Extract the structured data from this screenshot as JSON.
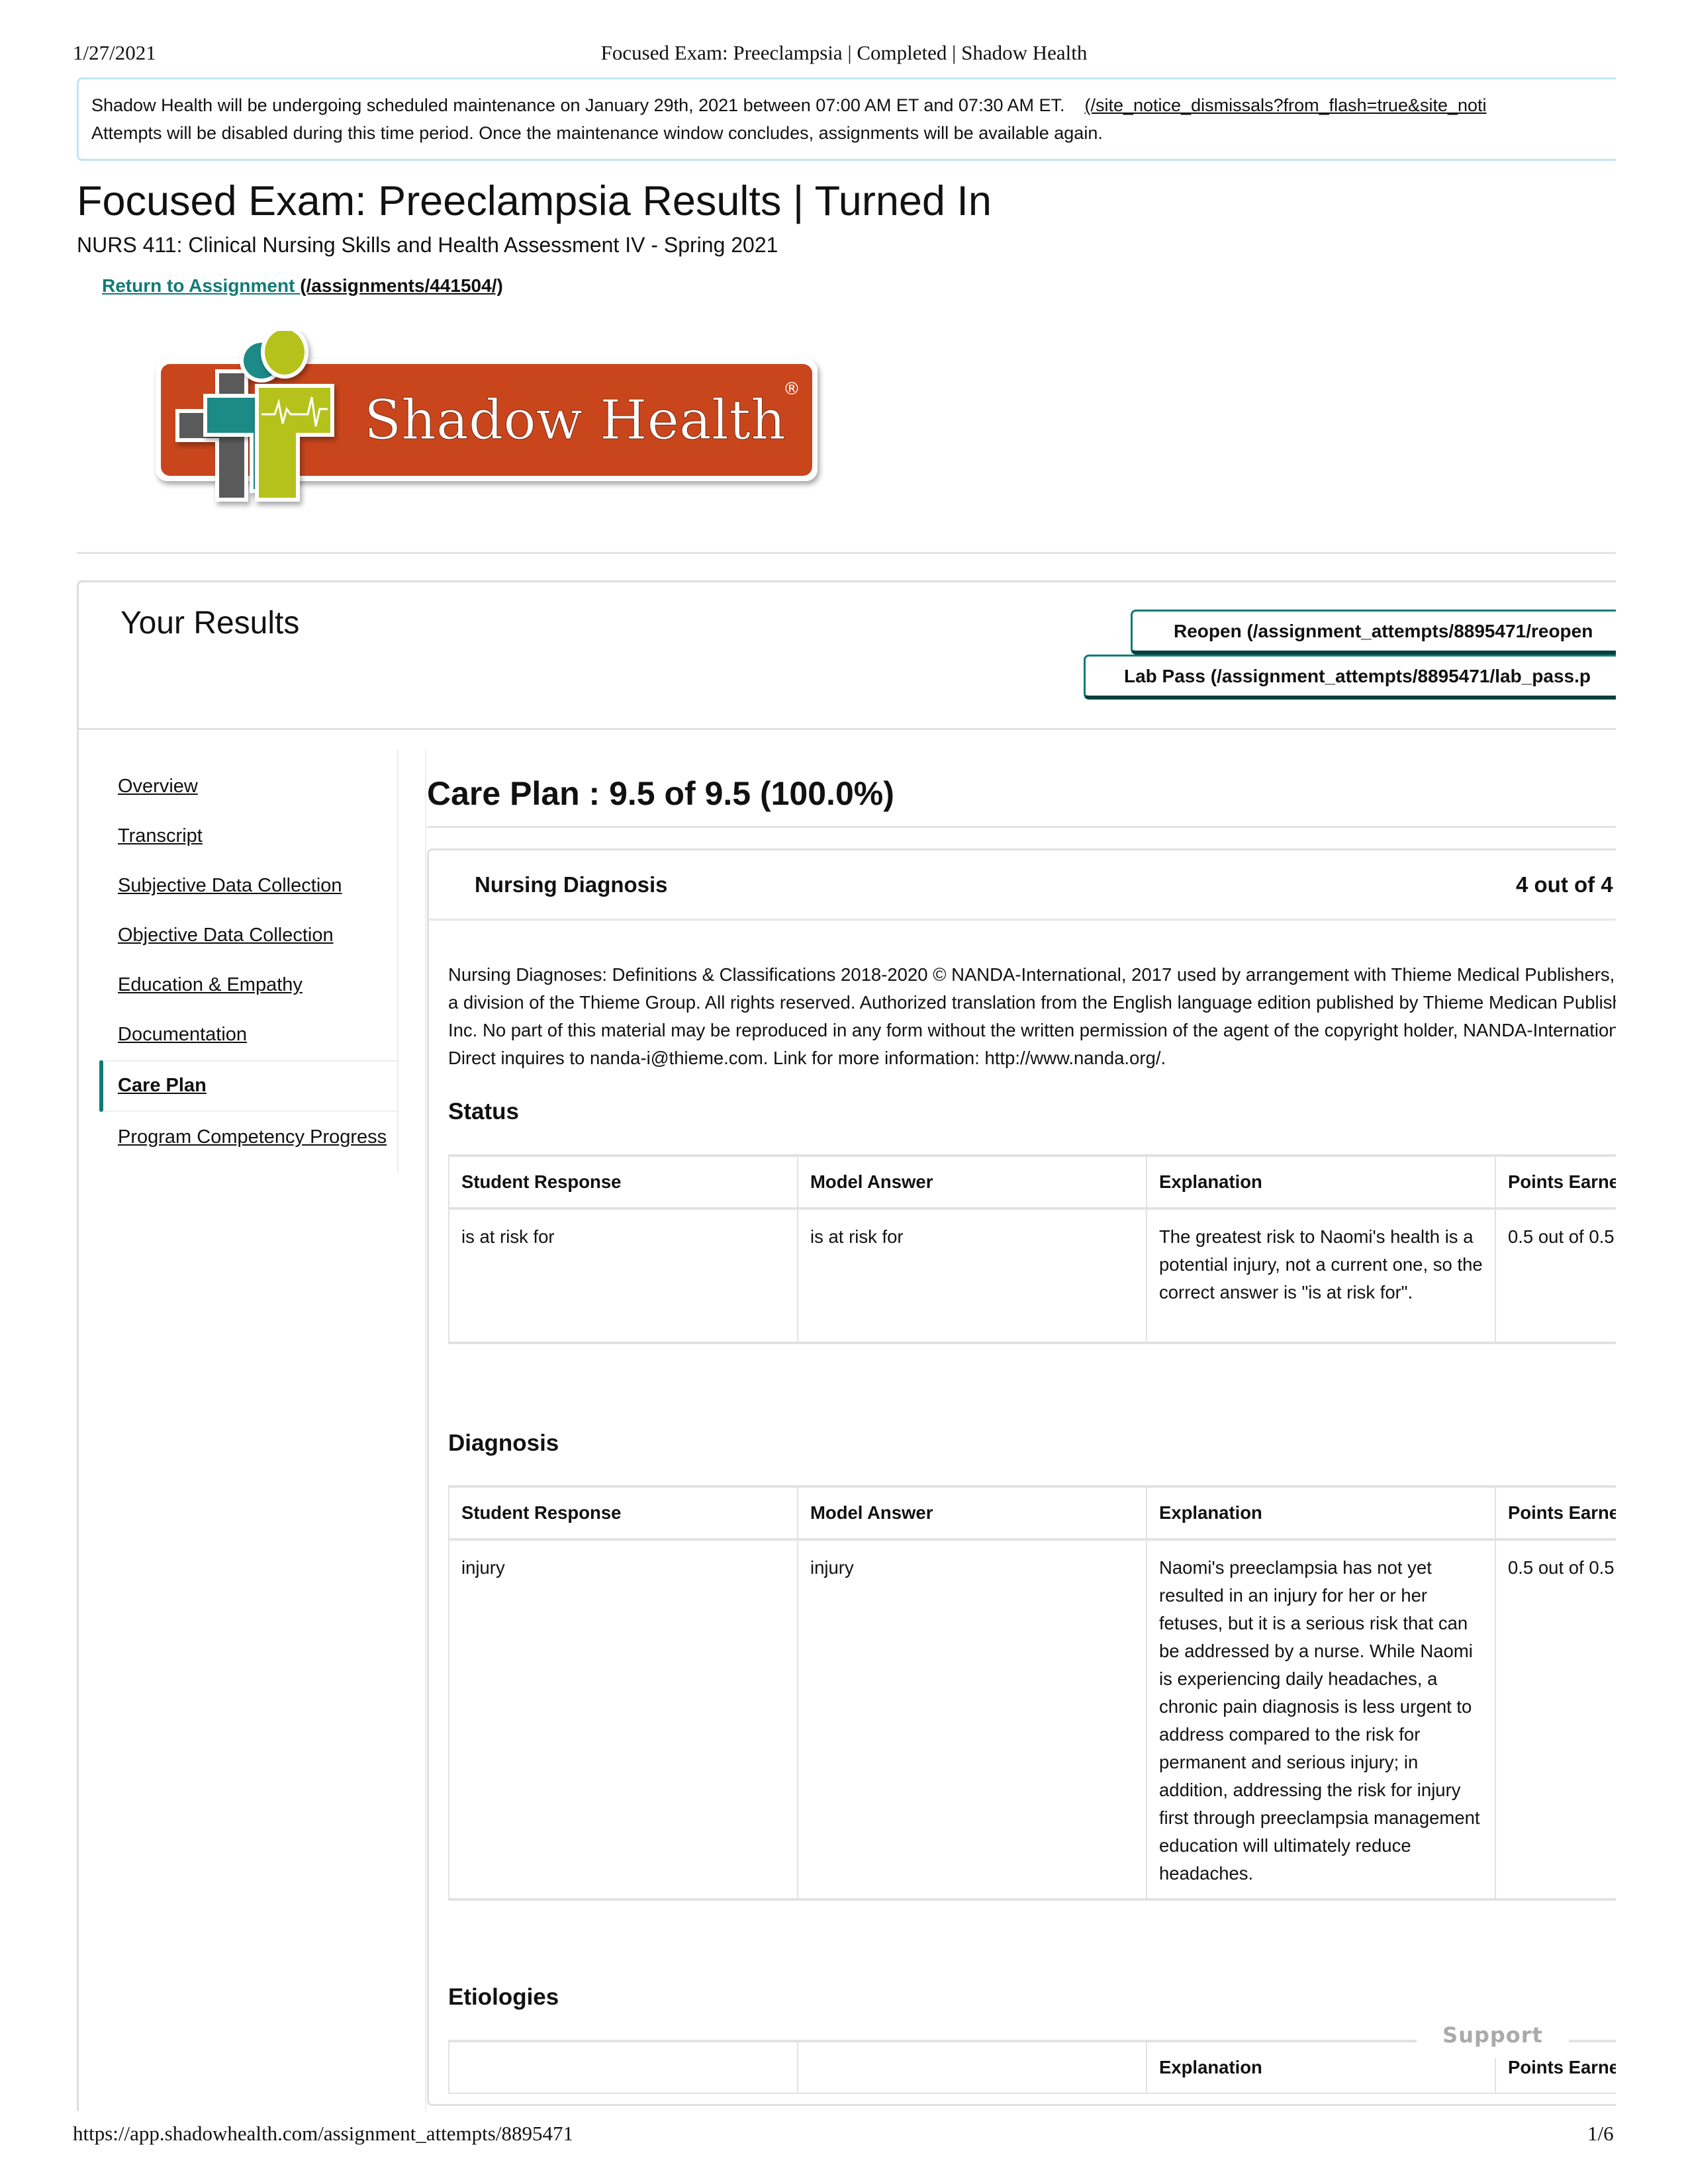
{
  "print_header": {
    "date": "1/27/2021",
    "title": "Focused Exam: Preeclampsia | Completed | Shadow Health"
  },
  "notice": {
    "line1": "Shadow Health will be undergoing scheduled maintenance on January 29th, 2021 between 07:00 AM ET and 07:30 AM ET.",
    "dismiss_link": "(/site_notice_dismissals?from_flash=true&site_noti",
    "line2": "Attempts will be disabled during this time period. Once the maintenance window concludes, assignments will be available again."
  },
  "page": {
    "title": "Focused Exam: Preeclampsia Results | Turned In",
    "subtitle": "NURS 411: Clinical Nursing Skills and Health Assessment IV - Spring 2021",
    "return_link": "Return to Assignment ",
    "return_path": "(/assignments/441504/)"
  },
  "logo": {
    "text": "Shadow Health",
    "registered": "®",
    "colors": {
      "banner": "#c9461d",
      "teal": "#1b8a87",
      "lime": "#b5c21a",
      "gray": "#5a5a5a"
    }
  },
  "results": {
    "heading": "Your Results",
    "reopen_button": "Reopen (/assignment_attempts/8895471/reopen",
    "lab_pass_button": "Lab Pass (/assignment_attempts/8895471/lab_pass.p"
  },
  "sidebar": {
    "items": [
      {
        "label": "Overview",
        "active": false
      },
      {
        "label": "Transcript",
        "active": false
      },
      {
        "label": "Subjective Data Collection",
        "active": false
      },
      {
        "label": "Objective Data Collection",
        "active": false
      },
      {
        "label": "Education & Empathy",
        "active": false
      },
      {
        "label": "Documentation",
        "active": false
      },
      {
        "label": "Care Plan",
        "active": true
      },
      {
        "label": "Program Competency Progress",
        "active": false
      }
    ]
  },
  "main": {
    "heading": "Care Plan : 9.5 of 9.5 (100.0%)",
    "nursing_diagnosis": {
      "title": "Nursing Diagnosis",
      "score": "4 out of 4",
      "copyright": "Nursing Diagnoses: Definitions & Classifications 2018-2020 © NANDA-International, 2017 used by arrangement with Thieme Medical Publishers, Inc., a division of the Thieme Group. All rights reserved. Authorized translation from the English language edition published by Thieme Medican Publishers Inc. No part of this material may be reproduced in any form without the written permission of the agent of the copyright holder, NANDA-International. Direct inquires to nanda-i@thieme.com. Link for more information: http://www.nanda.org/."
    },
    "columns": [
      "Student Response",
      "Model Answer",
      "Explanation",
      "Points Earned"
    ],
    "sections": [
      {
        "title": "Status",
        "rows": [
          {
            "student_response": "is at risk for",
            "model_answer": "is at risk for",
            "explanation": "The greatest risk to Naomi's health is a potential injury, not a current one, so the correct answer is \"is at risk for\".",
            "points": "0.5 out of 0.5"
          }
        ]
      },
      {
        "title": "Diagnosis",
        "rows": [
          {
            "student_response": "injury",
            "model_answer": "injury",
            "explanation": "Naomi's preeclampsia has not yet resulted in an injury for her or her fetuses, but it is a serious risk that can be addressed by a nurse. While Naomi is experiencing daily headaches, a chronic pain diagnosis is less urgent to address compared to the risk for permanent and serious injury; in addition, addressing the risk for injury first through preeclampsia management education will ultimately reduce headaches.",
            "points": "0.5 out of 0.5"
          }
        ]
      },
      {
        "title": "Etiologies",
        "header_visible": [
          "",
          "",
          "Explanation",
          "Points Earned"
        ]
      }
    ]
  },
  "support_button": "Support",
  "print_footer": {
    "url": "https://app.shadowhealth.com/assignment_attempts/8895471",
    "page": "1/6"
  }
}
